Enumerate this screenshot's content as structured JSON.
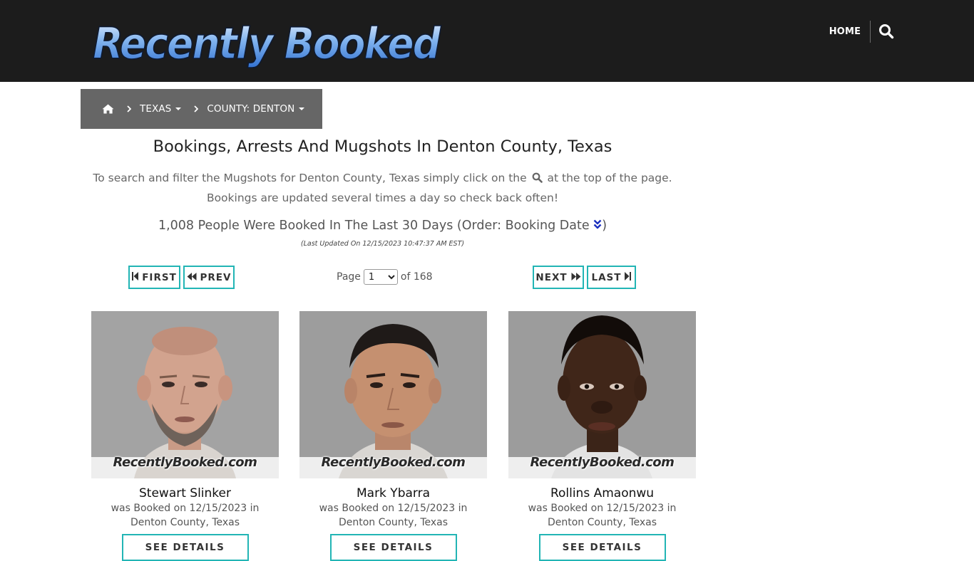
{
  "header": {
    "logo_text": "Recently Booked",
    "nav_home_label": "HOME",
    "search_icon": "search-icon"
  },
  "breadcrumb": {
    "home_icon": "home-icon",
    "state_label": "TEXAS",
    "county_label": "COUNTY: DENTON"
  },
  "main": {
    "title": "Bookings, Arrests And Mugshots In Denton County, Texas",
    "intro_before_icon": "To search and filter the Mugshots for Denton County, Texas simply click on the",
    "intro_after_icon": "at the top of the page. Bookings are updated several times a day so check back often!",
    "count_text": "1,008 People Were Booked In The Last 30 Days (Order: Booking Date",
    "count_close": ")",
    "updated_text": "(Last Updated On 12/15/2023 10:47:37 AM EST)"
  },
  "pager": {
    "first_label": "FIRST",
    "prev_label": "PREV",
    "next_label": "NEXT",
    "last_label": "LAST",
    "page_label": "Page",
    "current_page": "1",
    "of_label": "of 168"
  },
  "cards": [
    {
      "name": "Stewart Slinker",
      "booked_line1": "was Booked on 12/15/2023 in",
      "booked_line2": "Denton County, Texas",
      "watermark": "RecentlyBooked.com",
      "button_label": "SEE DETAILS"
    },
    {
      "name": "Mark Ybarra",
      "booked_line1": "was Booked on 12/15/2023 in",
      "booked_line2": "Denton County, Texas",
      "watermark": "RecentlyBooked.com",
      "button_label": "SEE DETAILS"
    },
    {
      "name": "Rollins Amaonwu",
      "booked_line1": "was Booked on 12/15/2023 in",
      "booked_line2": "Denton County, Texas",
      "watermark": "RecentlyBooked.com",
      "button_label": "SEE DETAILS"
    }
  ],
  "colors": {
    "header_bg": "#1c1c1c",
    "breadcrumb_bg": "#666666",
    "accent_teal": "#22b5b5",
    "sort_icon": "#1a2fbf"
  }
}
